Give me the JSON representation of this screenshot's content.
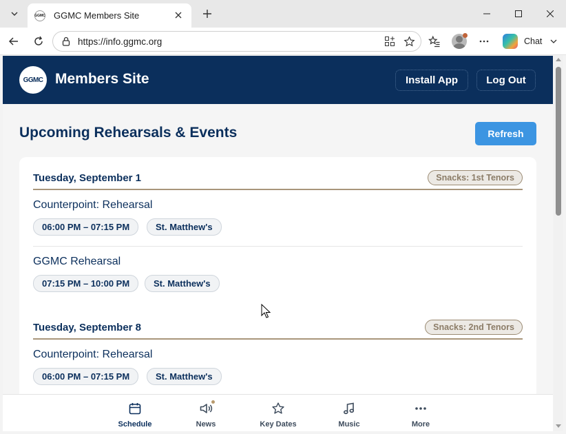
{
  "browser": {
    "tab_title": "GGMC Members Site",
    "favicon_text": "GGMC",
    "url": "https://info.ggmc.org",
    "copilot_label": "Chat"
  },
  "header": {
    "logo_text": "GGMC",
    "site_title": "Members Site",
    "install_label": "Install App",
    "logout_label": "Log Out",
    "bg_color": "#0b2f5c"
  },
  "main": {
    "title": "Upcoming Rehearsals & Events",
    "refresh_label": "Refresh",
    "days": [
      {
        "date": "Tuesday, September 1",
        "snacks": "Snacks: 1st Tenors",
        "events": [
          {
            "title": "Counterpoint: Rehearsal",
            "time": "06:00 PM – 07:15 PM",
            "location": "St. Matthew's"
          },
          {
            "title": "GGMC Rehearsal",
            "time": "07:15 PM – 10:00 PM",
            "location": "St. Matthew's"
          }
        ]
      },
      {
        "date": "Tuesday, September 8",
        "snacks": "Snacks: 2nd Tenors",
        "events": [
          {
            "title": "Counterpoint: Rehearsal",
            "time": "06:00 PM – 07:15 PM",
            "location": "St. Matthew's"
          }
        ]
      }
    ]
  },
  "bottom_nav": {
    "items": [
      {
        "label": "Schedule",
        "icon": "calendar-icon",
        "active": true
      },
      {
        "label": "News",
        "icon": "megaphone-icon",
        "badge": true
      },
      {
        "label": "Key Dates",
        "icon": "star-icon"
      },
      {
        "label": "Music",
        "icon": "music-note-icon"
      },
      {
        "label": "More",
        "icon": "more-dots-icon"
      }
    ]
  },
  "colors": {
    "accent": "#3c95e2",
    "navy": "#0b2f5c",
    "snack_border": "#9a8a72"
  }
}
